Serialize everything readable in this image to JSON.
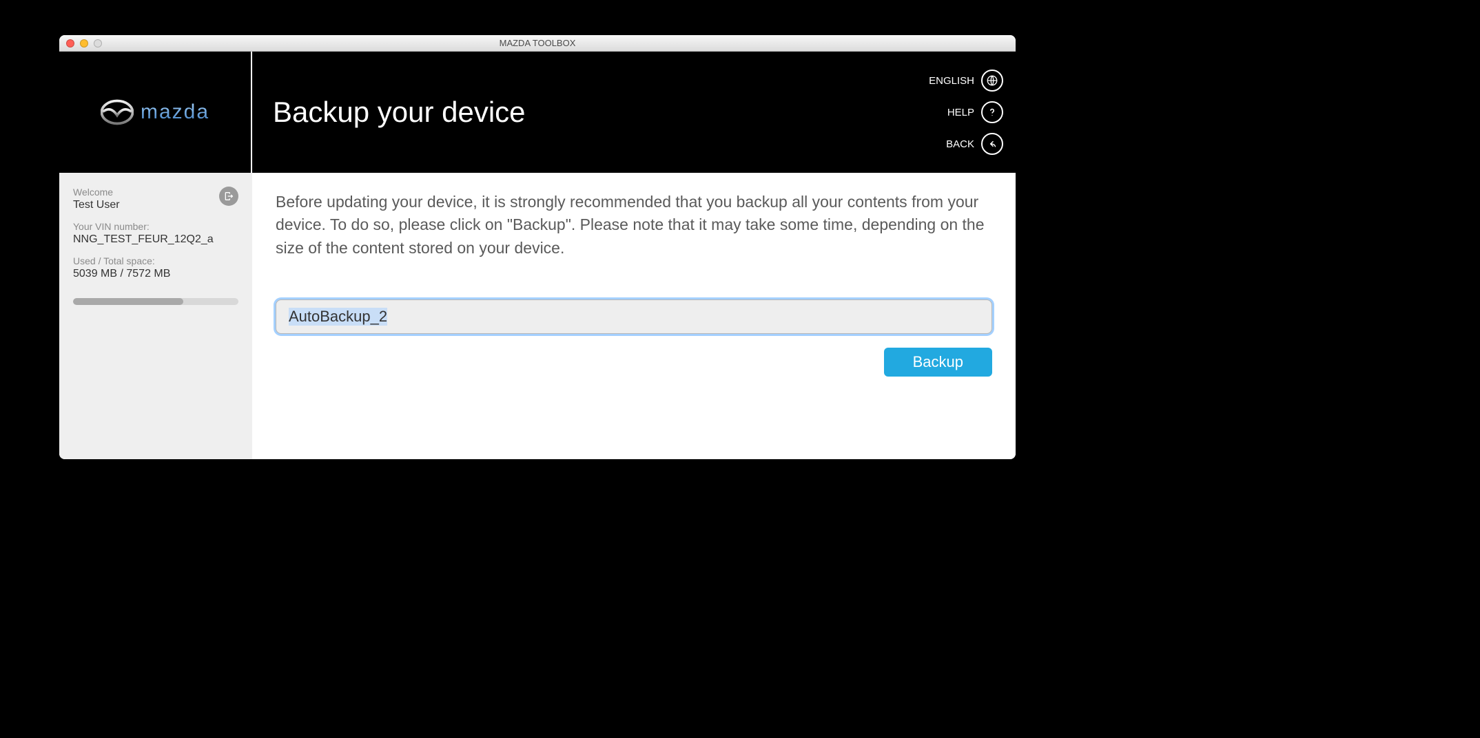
{
  "window": {
    "title": "MAZDA TOOLBOX"
  },
  "header": {
    "brand": "mazda",
    "page_title": "Backup your device",
    "links": {
      "language_label": "ENGLISH",
      "help_label": "HELP",
      "back_label": "BACK"
    }
  },
  "sidebar": {
    "welcome_label": "Welcome",
    "user_name": "Test User",
    "vin_label": "Your VIN number:",
    "vin_value": "NNG_TEST_FEUR_12Q2_a",
    "space_label": "Used / Total space:",
    "space_value": "5039 MB / 7572 MB",
    "used_mb": 5039,
    "total_mb": 7572
  },
  "main": {
    "description": "Before updating your device, it is strongly recommended that you backup all your contents from your device. To do so, please click on \"Backup\". Please note that it may take some time, depending on the size of the content stored on your device.",
    "backup_name_value": "AutoBackup_2",
    "backup_button_label": "Backup"
  },
  "colors": {
    "accent": "#22a9e0"
  }
}
